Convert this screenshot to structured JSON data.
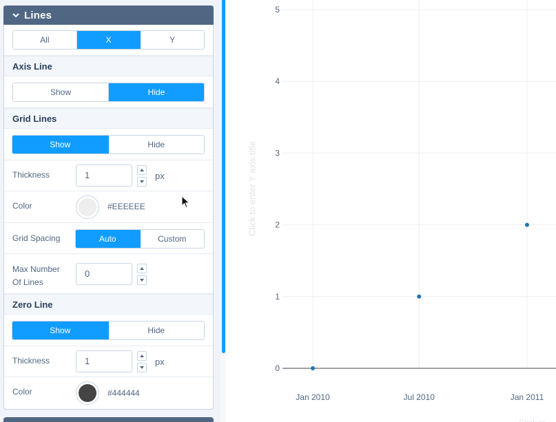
{
  "panel": {
    "title": "Lines",
    "axis_selector": {
      "options": [
        "All",
        "X",
        "Y"
      ],
      "selected": "X"
    },
    "axis_line": {
      "title": "Axis Line",
      "options": [
        "Show",
        "Hide"
      ],
      "selected": "Hide"
    },
    "grid_lines": {
      "title": "Grid Lines",
      "options": [
        "Show",
        "Hide"
      ],
      "selected": "Show",
      "thickness": {
        "label": "Thickness",
        "value": "1",
        "unit": "px"
      },
      "color": {
        "label": "Color",
        "value": "#EEEEEE",
        "swatch": "#eeeeee"
      },
      "spacing": {
        "label": "Grid Spacing",
        "options": [
          "Auto",
          "Custom"
        ],
        "selected": "Auto"
      },
      "max_lines": {
        "label": "Max Number Of Lines",
        "value": "0"
      }
    },
    "zero_line": {
      "title": "Zero Line",
      "options": [
        "Show",
        "Hide"
      ],
      "selected": "Show",
      "thickness": {
        "label": "Thickness",
        "value": "1",
        "unit": "px"
      },
      "color": {
        "label": "Color",
        "value": "#444444",
        "swatch": "#444444"
      }
    }
  },
  "plot": {
    "y_axis_title_placeholder": "Click to enter Y axis title",
    "x_axis_title_placeholder": "Click to",
    "marker_color": "#1f77b4",
    "gridline_color": "#eeeeee"
  },
  "chart_data": {
    "type": "scatter",
    "x": [
      "2010-01-01",
      "2010-07-01",
      "2011-01-01"
    ],
    "y": [
      0,
      1,
      2
    ],
    "xtick_labels": [
      "Jan 2010",
      "Jul 2010",
      "Jan 2011"
    ],
    "ytick_labels": [
      "0",
      "1",
      "2",
      "3",
      "4",
      "5"
    ],
    "ylim": [
      0,
      5
    ],
    "grid": true
  }
}
